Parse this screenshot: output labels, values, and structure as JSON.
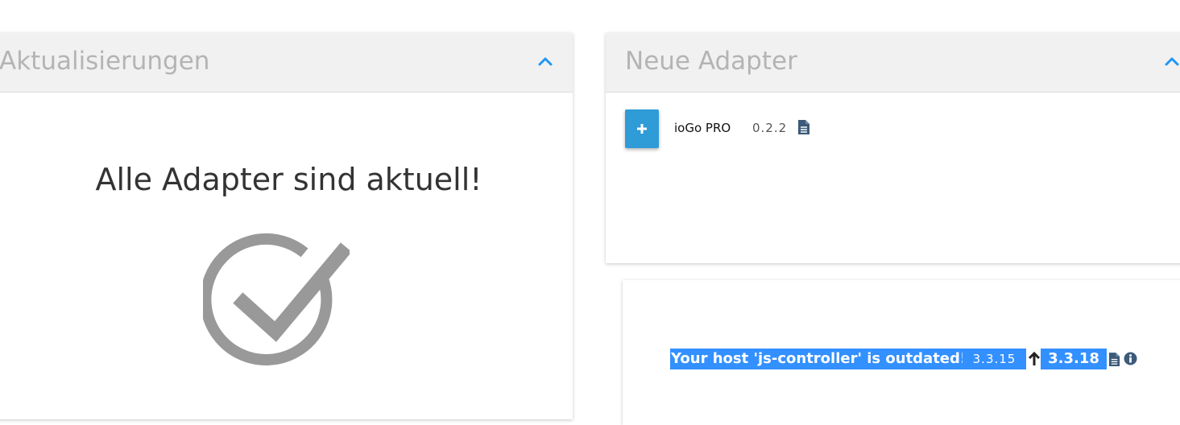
{
  "updates": {
    "title": "Aktualisierungen",
    "empty_message": "Alle Adapter sind aktuell!"
  },
  "new_adapters": {
    "title": "Neue Adapter",
    "items": [
      {
        "name": "ioGo PRO",
        "version": "0.2.2"
      }
    ]
  },
  "host": {
    "message": "Your host 'js-controller' is outdated!",
    "current_version": "3.3.15",
    "new_version": "3.3.18"
  },
  "colors": {
    "accent": "#2f9bd7",
    "highlight": "#3390ff",
    "chevron": "#2196f3",
    "header_bg": "#f1f1f1",
    "title_gray": "#b4b4b4"
  },
  "icons": [
    "chevron-up-icon",
    "plus-icon",
    "document-icon",
    "checkmark-circle-icon",
    "arrow-up-icon",
    "info-icon"
  ]
}
